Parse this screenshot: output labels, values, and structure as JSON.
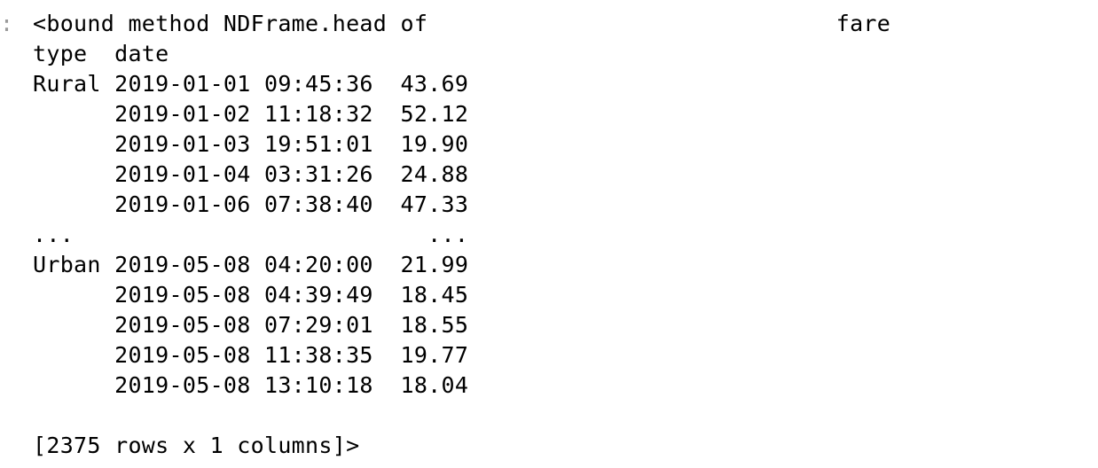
{
  "cell": {
    "prompt_marker": ":"
  },
  "output": {
    "lines": [
      "<bound method NDFrame.head of                              fare",
      "type  date                         ",
      "Rural 2019-01-01 09:45:36  43.69",
      "      2019-01-02 11:18:32  52.12",
      "      2019-01-03 19:51:01  19.90",
      "      2019-01-04 03:31:26  24.88",
      "      2019-01-06 07:38:40  47.33",
      "...                          ...",
      "Urban 2019-05-08 04:20:00  21.99",
      "      2019-05-08 04:39:49  18.45",
      "      2019-05-08 07:29:01  18.55",
      "      2019-05-08 11:38:35  19.77",
      "      2019-05-08 13:10:18  18.04",
      "",
      "[2375 rows x 1 columns]>"
    ]
  }
}
